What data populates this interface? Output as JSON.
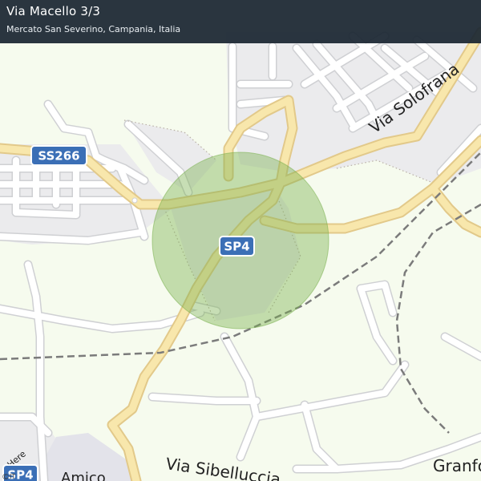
{
  "header": {
    "title": "Via Macello 3/3",
    "subtitle": "Mercato San Severino, Campania, Italia"
  },
  "shields": {
    "ss266": "SS266",
    "sp4_center": "SP4",
    "sp4_corner": "SP4"
  },
  "streets": {
    "via_solofrana": "Via  Solofrana",
    "via_sibelluccia": "Via  Sibelluccia",
    "granfo": "Granfo",
    "here_partial": "Here"
  },
  "places": {
    "amico_partial": "Amico"
  },
  "attribution": {
    "copyright": "©",
    "country_code": "IT"
  },
  "colors": {
    "land": "#f6fbee",
    "built_area": "#ebebed",
    "road_minor": "#ffffff",
    "road_casing": "#cfd0d3",
    "road_major": "#f8e7ac",
    "railway": "#7b7b7b",
    "accuracy_circle": "#7ab04f",
    "shield": "#3b6fb6",
    "header_bg": "#1a2632"
  }
}
